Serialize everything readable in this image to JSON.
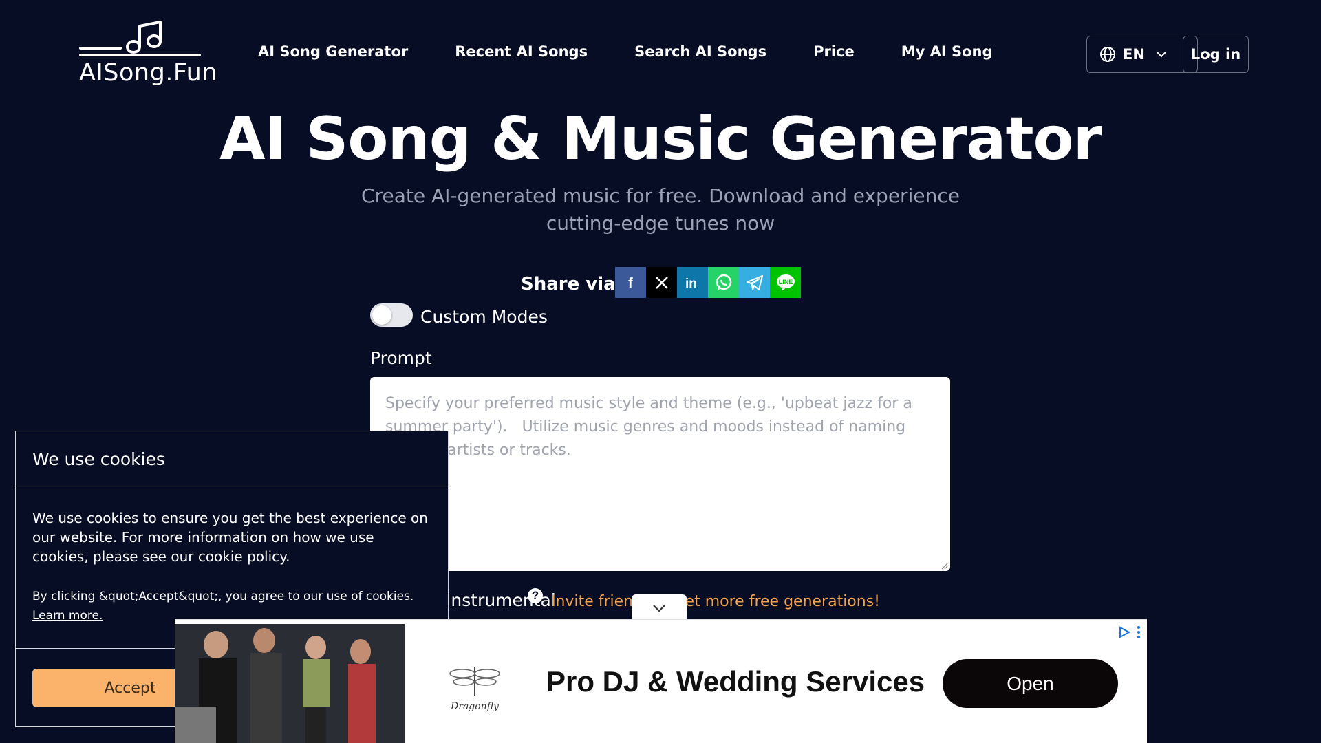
{
  "header": {
    "logo_text": "AISong.Fun",
    "nav": [
      "AI Song Generator",
      "Recent AI Songs",
      "Search AI Songs",
      "Price",
      "My AI Song"
    ],
    "language": "EN",
    "login_label": "Log in"
  },
  "hero": {
    "title": "AI Song & Music Generator",
    "subtitle": "Create AI-generated music for free. Download and experience cutting-edge tunes now"
  },
  "share": {
    "label": "Share via:",
    "networks": [
      {
        "name": "facebook",
        "color": "#3b5998",
        "icon": "facebook-icon"
      },
      {
        "name": "x",
        "color": "#000000",
        "icon": "x-icon"
      },
      {
        "name": "linkedin",
        "color": "#0e76a8",
        "icon": "linkedin-icon"
      },
      {
        "name": "whatsapp",
        "color": "#25d366",
        "icon": "whatsapp-icon"
      },
      {
        "name": "telegram",
        "color": "#37aee2",
        "icon": "telegram-icon"
      },
      {
        "name": "line",
        "color": "#00c300",
        "icon": "line-icon"
      }
    ]
  },
  "form": {
    "custom_modes_label": "Custom Modes",
    "custom_modes_on": false,
    "prompt_label": "Prompt",
    "prompt_placeholder": "Specify your preferred music style and theme (e.g., 'upbeat jazz for a summer party').   Utilize music genres and moods instead of naming specific artists or tracks.",
    "prompt_value": "",
    "instrumental_label": "Instrumental",
    "invite_text": "Invite friends to get more free generations!"
  },
  "cookie": {
    "title": "We use cookies",
    "body": "We use cookies to ensure you get the best experience on our website. For more information on how we use cookies, please see our cookie policy.",
    "consent": "By clicking &quot;Accept&quot;, you agree to our use of cookies.",
    "learn_more": "Learn more.",
    "accept_label": "Accept"
  },
  "ad": {
    "brand": "Dragonfly",
    "title": "Pro DJ & Wedding Services",
    "cta": "Open"
  },
  "colors": {
    "background": "#060d24",
    "accent_orange": "#f4a24b",
    "accept_button": "#fbb26a",
    "muted_text": "#9aa3b6"
  }
}
